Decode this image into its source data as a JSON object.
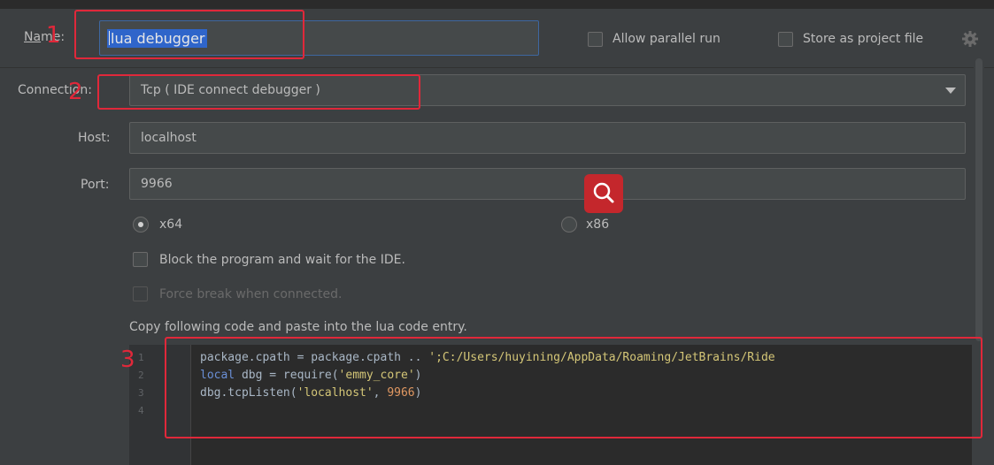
{
  "name": {
    "label": "Name:",
    "value": "lua debugger"
  },
  "options": {
    "allow_parallel_run": "Allow parallel run",
    "store_as_project_file": "Store as project file"
  },
  "connection": {
    "label": "Connection:",
    "value": "Tcp ( IDE connect debugger )"
  },
  "host": {
    "label": "Host:",
    "value": "localhost"
  },
  "port": {
    "label": "Port:",
    "value": "9966"
  },
  "arch": {
    "x64": "x64",
    "x86": "x86",
    "selected": "x64"
  },
  "block_program": "Block the program and wait for the IDE.",
  "force_break": "Force break when connected.",
  "copy_hint": "Copy following code and paste into the lua code entry.",
  "code": {
    "line_numbers": [
      "1",
      "2",
      "3",
      "4"
    ],
    "line1": {
      "a": "package.cpath = package.cpath .. ",
      "b": "';C:/Users/huyining/AppData/Roaming/JetBrains/Ride"
    },
    "line2": {
      "kw": "local",
      "a": " dbg = require(",
      "b": "'emmy_core'",
      "c": ")"
    },
    "line3": {
      "a": "dbg.tcpListen(",
      "b": "'localhost'",
      "c": ", ",
      "d": "9966",
      "e": ")"
    }
  },
  "annotations": {
    "m1": "1",
    "m2": "2",
    "m3": "3"
  },
  "colors": {
    "accent_red": "#e0283a",
    "selection_blue": "#2f65ca",
    "background": "#3c3f41"
  }
}
